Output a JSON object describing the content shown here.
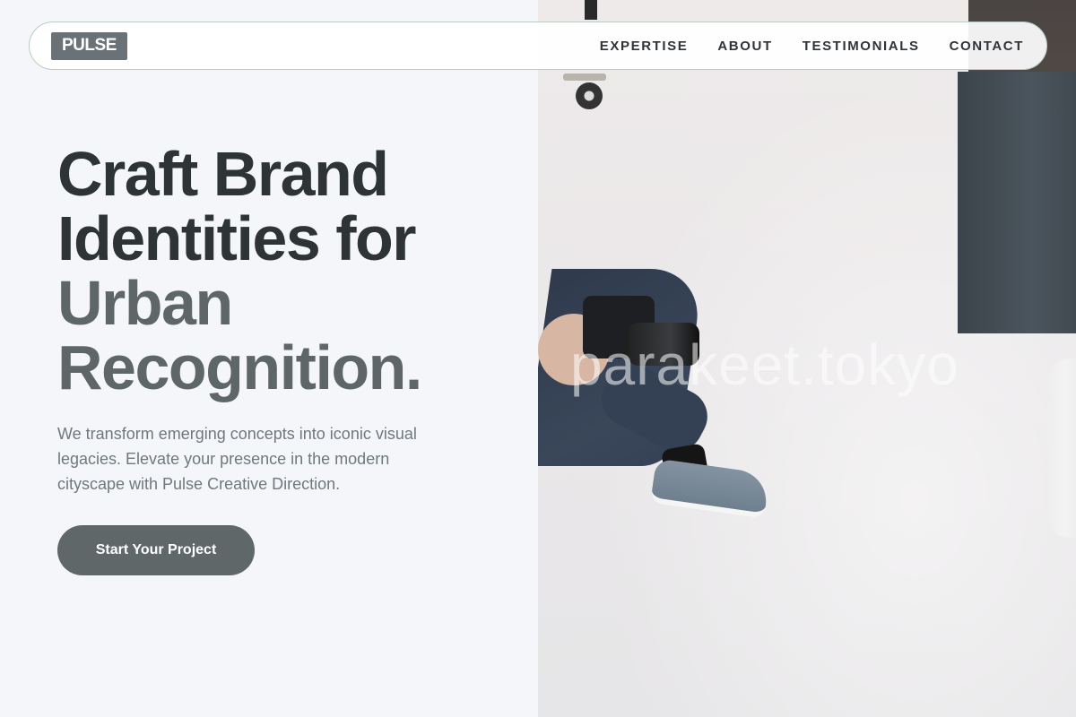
{
  "brand": {
    "logo_text": "PULSE"
  },
  "nav": {
    "links": [
      "EXPERTISE",
      "ABOUT",
      "TESTIMONIALS",
      "CONTACT"
    ]
  },
  "hero": {
    "title_line1": "Craft Brand",
    "title_line2": "Identities for",
    "title_line3": "Urban",
    "title_line4": "Recognition.",
    "subtitle": "We transform emerging concepts into iconic visual legacies. Elevate your presence in the modern cityscape with Pulse Creative Direction.",
    "cta_label": "Start Your Project"
  },
  "image": {
    "watermark": "parakeet.tokyo"
  },
  "colors": {
    "background": "#f5f6fa",
    "title": "#2e3336",
    "title_accent": "#5e6668",
    "button": "#5f6768",
    "logo_bg": "#6b7277"
  }
}
